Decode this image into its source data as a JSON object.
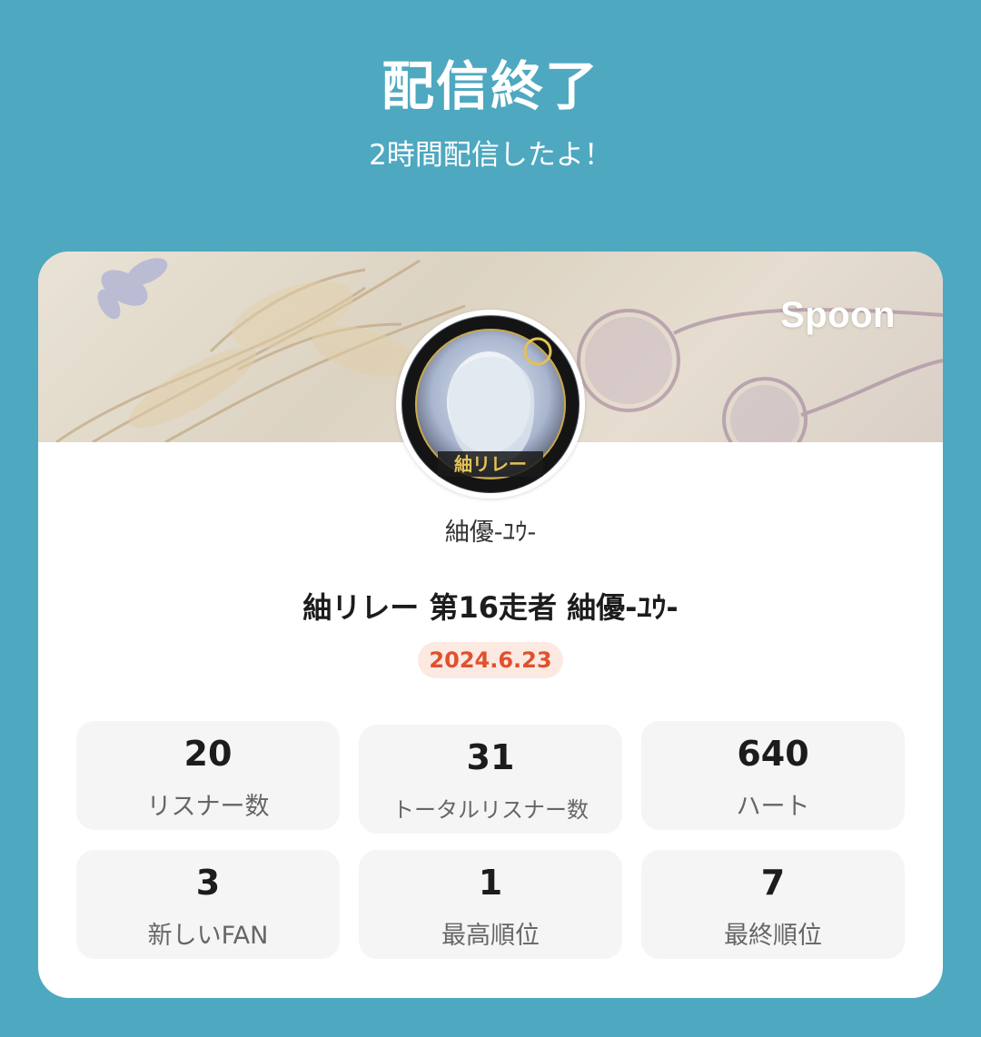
{
  "header": {
    "title": "配信終了",
    "subtitle": "2時間配信したよ！"
  },
  "card": {
    "brand": "Spoon",
    "dj_name": "紬優-ﾕｳ-",
    "live_title": "紬リレー 第16走者 紬優-ﾕｳ-",
    "date": "2024.6.23",
    "stats": [
      {
        "value": "20",
        "label": "リスナー数"
      },
      {
        "value": "31",
        "label": "トータルリスナー数"
      },
      {
        "value": "640",
        "label": "ハート"
      },
      {
        "value": "3",
        "label": "新しいFAN"
      },
      {
        "value": "1",
        "label": "最高順位"
      },
      {
        "value": "7",
        "label": "最終順位"
      }
    ]
  },
  "colors": {
    "background": "#4ea8c0",
    "date_text": "#e0512d",
    "date_badge_bg": "#fce9e2",
    "stat_bg": "#f5f5f5"
  },
  "icons": {
    "avatar": "profile-avatar-image",
    "banner": "decorative-banner-image"
  }
}
